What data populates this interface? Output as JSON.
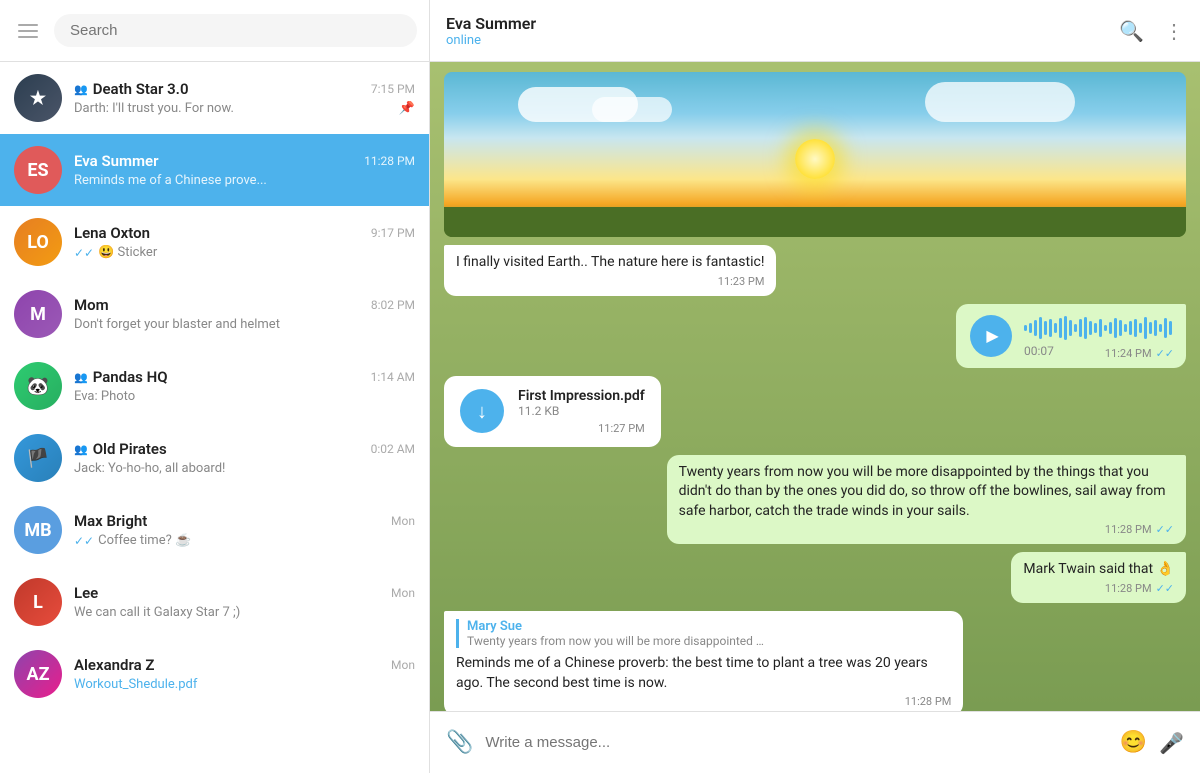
{
  "sidebar": {
    "search_placeholder": "Search",
    "menu_icon": "menu-icon",
    "chats": [
      {
        "id": "death-star",
        "name": "Death Star 3.0",
        "preview": "Darth: I'll trust you. For now.",
        "time": "7:15 PM",
        "avatar_text": "★",
        "avatar_class": "av-death",
        "is_group": true,
        "pinned": true,
        "checks": ""
      },
      {
        "id": "eva-summer",
        "name": "Eva Summer",
        "preview": "Reminds me of a Chinese prove...",
        "time": "11:28 PM",
        "avatar_text": "ES",
        "avatar_class": "avatar-es",
        "is_group": false,
        "active": true,
        "checks": ""
      },
      {
        "id": "lena-oxton",
        "name": "Lena Oxton",
        "preview": "😃 Sticker",
        "time": "9:17 PM",
        "avatar_text": "LO",
        "avatar_class": "av-lena",
        "is_group": false,
        "checks": "✓✓"
      },
      {
        "id": "mom",
        "name": "Mom",
        "preview": "Don't forget your blaster and helmet",
        "time": "8:02 PM",
        "avatar_text": "M",
        "avatar_class": "av-mom",
        "is_group": false,
        "checks": ""
      },
      {
        "id": "pandas-hq",
        "name": "Pandas HQ",
        "preview": "Eva: Photo",
        "time": "1:14 AM",
        "avatar_text": "🐼",
        "avatar_class": "av-pandas",
        "is_group": true,
        "checks": ""
      },
      {
        "id": "old-pirates",
        "name": "Old Pirates",
        "preview": "Jack: Yo-ho-ho, all aboard!",
        "time": "0:02 AM",
        "avatar_text": "🏴",
        "avatar_class": "av-pirates",
        "is_group": true,
        "checks": ""
      },
      {
        "id": "max-bright",
        "name": "Max Bright",
        "preview": "Coffee time? ☕",
        "time": "Mon",
        "avatar_text": "MB",
        "avatar_class": "avatar-mb",
        "is_group": false,
        "checks": "✓✓"
      },
      {
        "id": "lee",
        "name": "Lee",
        "preview": "We can call it Galaxy Star 7 ;)",
        "time": "Mon",
        "avatar_text": "L",
        "avatar_class": "av-lee",
        "is_group": false,
        "checks": ""
      },
      {
        "id": "alexandra",
        "name": "Alexandra Z",
        "preview": "Workout_Shedule.pdf",
        "time": "Mon",
        "avatar_text": "AZ",
        "avatar_class": "av-alex",
        "is_group": false,
        "checks": "",
        "preview_link": true
      }
    ]
  },
  "chat": {
    "contact_name": "Eva Summer",
    "status": "online",
    "search_icon": "🔍",
    "more_icon": "⋮",
    "messages": [
      {
        "id": "msg1",
        "type": "text_incoming",
        "text": "I finally visited Earth.. The nature here is fantastic!",
        "time": "11:23 PM"
      },
      {
        "id": "msg2",
        "type": "voice_outgoing",
        "duration": "00:07",
        "time": "11:24 PM",
        "checks": "✓✓"
      },
      {
        "id": "msg3",
        "type": "file_incoming",
        "file_name": "First Impression.pdf",
        "file_size": "11.2 KB",
        "time": "11:27 PM"
      },
      {
        "id": "msg4",
        "type": "text_outgoing",
        "text": "Twenty years from now you will be more disappointed by the things that you didn't do than by the ones you did do, so throw off the bowlines, sail away from safe harbor, catch the trade winds in your sails.",
        "time": "11:28 PM",
        "checks": "✓✓"
      },
      {
        "id": "msg5",
        "type": "text_outgoing",
        "text": "Mark Twain said that 👌",
        "time": "11:28 PM",
        "checks": "✓✓"
      },
      {
        "id": "msg6",
        "type": "reply_incoming",
        "quote_author": "Mary Sue",
        "quote_text": "Twenty years from now you will be more disappointed by t...",
        "text": "Reminds me of a Chinese proverb: the best time to plant a tree was 20 years ago. The second best time is now.",
        "time": "11:28 PM"
      }
    ],
    "input_placeholder": "Write a message..."
  }
}
